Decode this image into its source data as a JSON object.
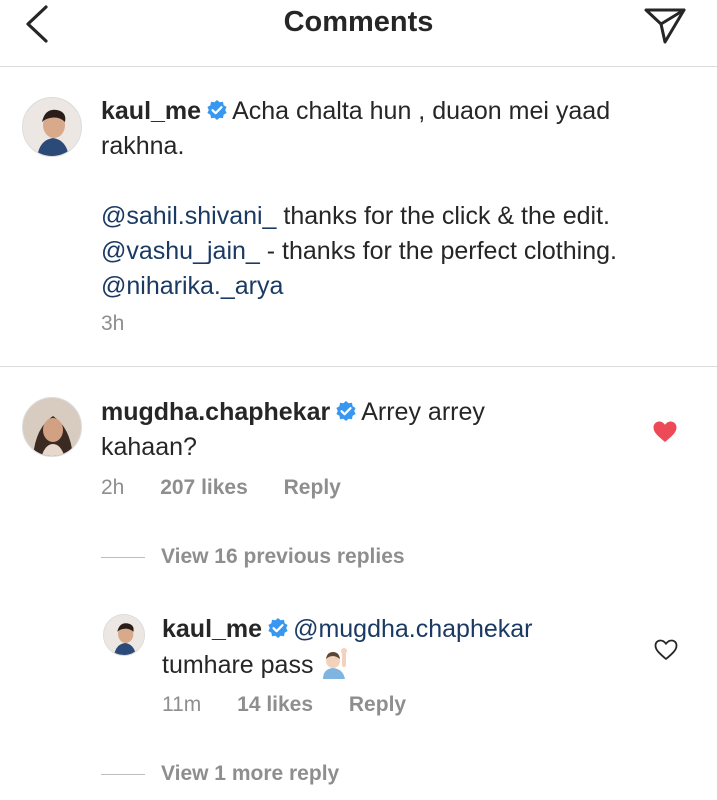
{
  "header": {
    "title": "Comments",
    "back_icon": "chevron-left-icon",
    "send_icon": "paper-plane-icon"
  },
  "caption": {
    "username": "kaul_me",
    "text_line1": "Acha chalta hun , duaon mei yaad",
    "text_line2": "rakhna.",
    "mention1": "@sahil.shivani_",
    "line3_rest": "thanks for the click & the edit.",
    "mention2": "@vashu_jain_",
    "line4_rest": "- thanks for the perfect clothing.",
    "mention3": "@niharika._arya",
    "time": "3h"
  },
  "comment": {
    "username": "mugdha.chaphekar",
    "text_line1": "Arrey arrey",
    "text_line2": "kahaan?",
    "time": "2h",
    "likes": "207 likes",
    "reply_label": "Reply",
    "liked": true,
    "heart_color": "#ed4956"
  },
  "view_previous": "View 16 previous replies",
  "reply": {
    "username": "kaul_me",
    "mention": "@mugdha.chaphekar",
    "text": "tumhare pass",
    "emoji": "person-raising-hand-emoji",
    "time": "11m",
    "likes": "14 likes",
    "reply_label": "Reply",
    "liked": false
  },
  "view_more": "View 1 more reply",
  "colors": {
    "verified": "#3897f0",
    "mention": "#1b3a63",
    "secondary_text": "#8e8e8e",
    "divider": "#dbdbdb"
  }
}
